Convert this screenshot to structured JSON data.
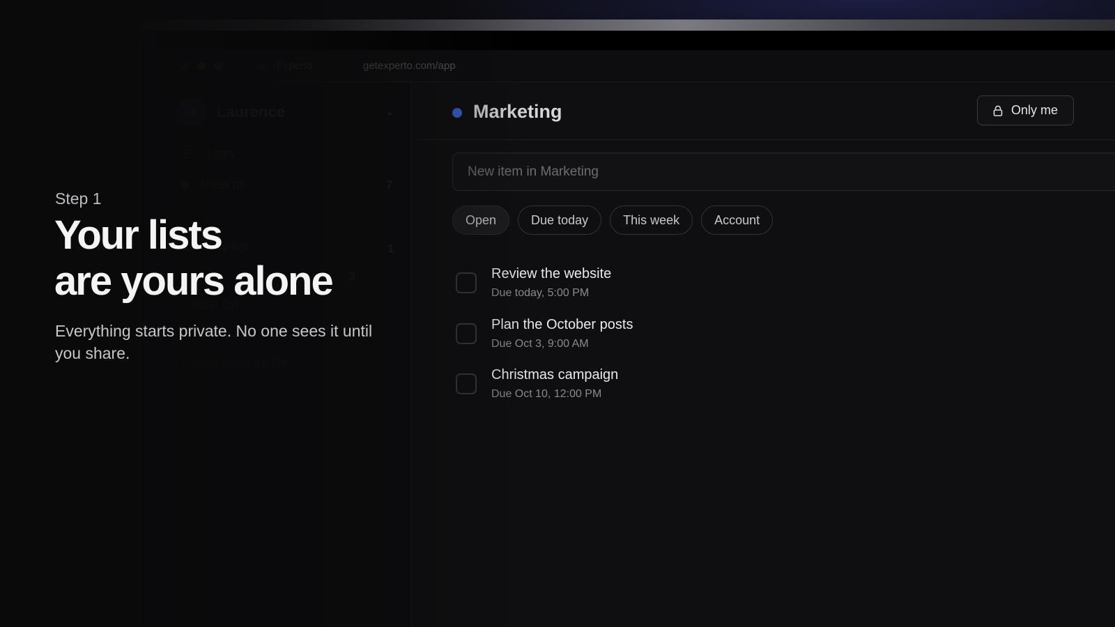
{
  "browser": {
    "tab_title": "Experto",
    "url": "getexperto.com/app"
  },
  "sidebar": {
    "avatar_initials": "LA",
    "user_name": "Laurence",
    "lists_label": "Lists",
    "view_all_label": "View all",
    "view_all_count": "7",
    "my_list_label": "y list",
    "my_list_count": "1",
    "other_count": "3",
    "new_list_label": "New list",
    "new_account_list_label": "+ New account list"
  },
  "list": {
    "title": "Marketing",
    "accent_color": "#3d63d6",
    "share_label": "Only me",
    "new_item_placeholder": "New item in Marketing",
    "filters": [
      "Open",
      "Due today",
      "This week",
      "Account"
    ],
    "active_filter": "Open",
    "items": [
      {
        "title": "Review the website",
        "due": "Due today, 5:00 PM"
      },
      {
        "title": "Plan the October posts",
        "due": "Due Oct 3, 9:00 AM"
      },
      {
        "title": "Christmas campaign",
        "due": "Due Oct 10, 12:00 PM"
      }
    ]
  },
  "marketing_copy": {
    "step": "Step 1",
    "headline_line1": "Your lists",
    "headline_line2": "are yours alone",
    "subcopy": "Everything starts private. No one sees it until you share."
  }
}
